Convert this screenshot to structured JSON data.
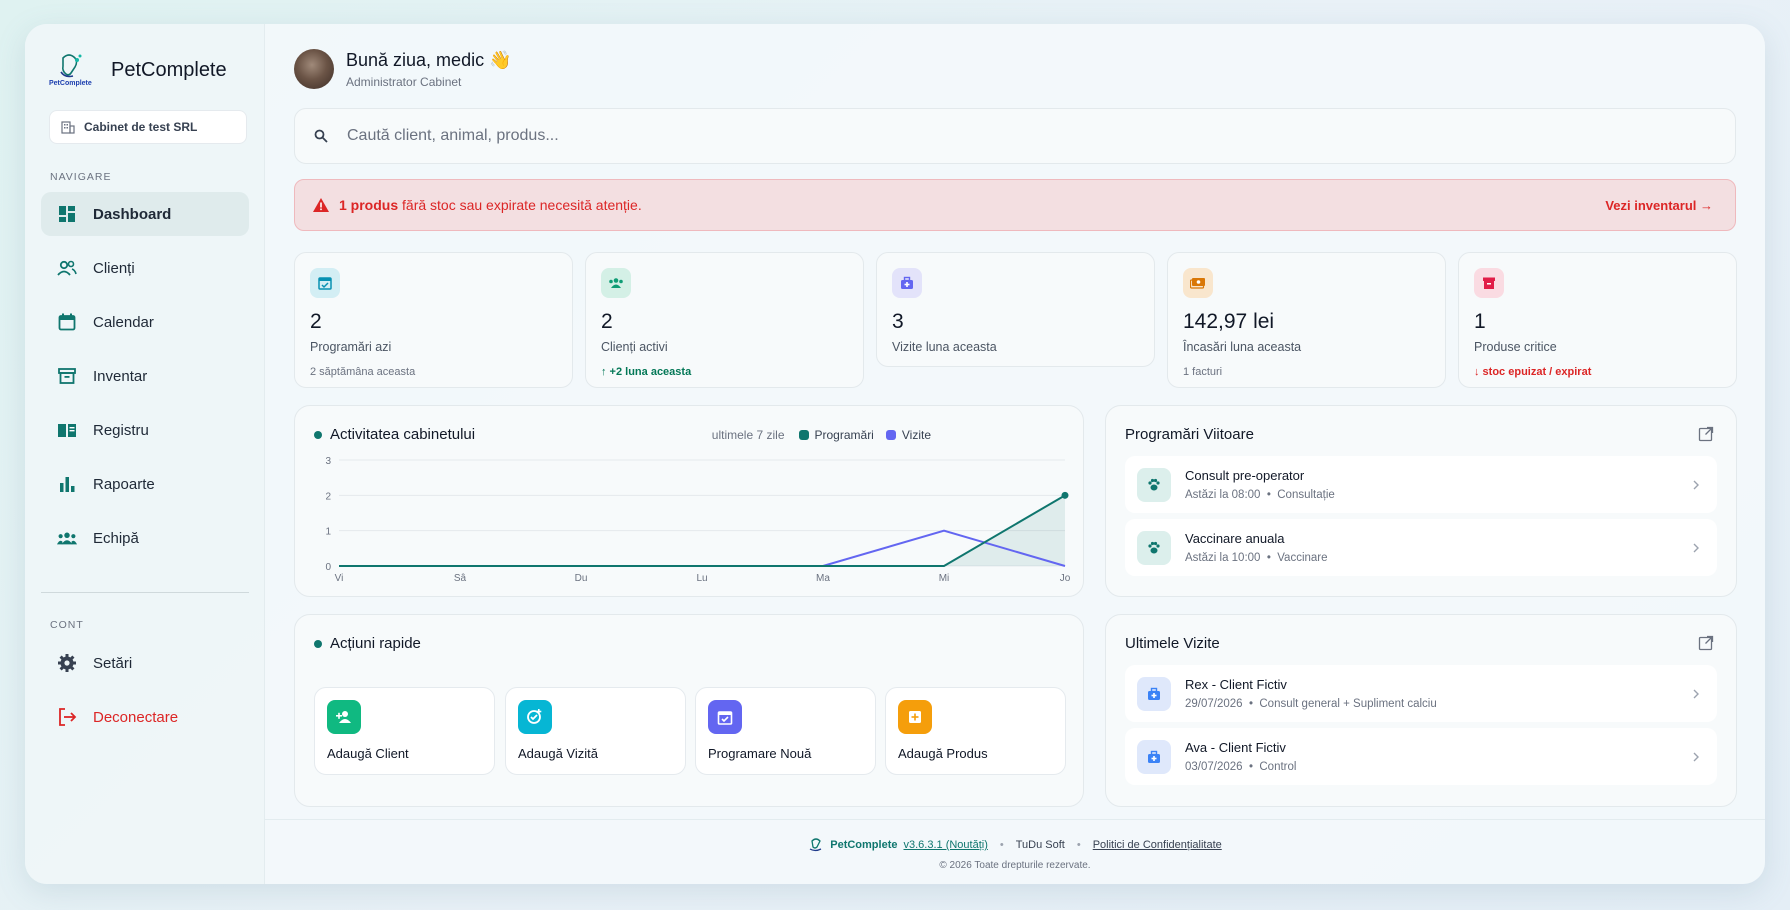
{
  "brand": {
    "name": "PetComplete",
    "logo_text": "PetComplete"
  },
  "clinic": {
    "name": "Cabinet de test SRL"
  },
  "sidebar": {
    "nav_label": "NAVIGARE",
    "items": [
      {
        "label": "Dashboard",
        "icon": "dashboard-icon",
        "active": true
      },
      {
        "label": "Clienți",
        "icon": "users-icon"
      },
      {
        "label": "Calendar",
        "icon": "calendar-icon"
      },
      {
        "label": "Inventar",
        "icon": "archive-icon"
      },
      {
        "label": "Registru",
        "icon": "book-icon"
      },
      {
        "label": "Rapoarte",
        "icon": "bar-chart-icon"
      },
      {
        "label": "Echipă",
        "icon": "team-icon"
      }
    ],
    "account_label": "CONT",
    "settings": "Setări",
    "logout": "Deconectare"
  },
  "header": {
    "greeting": "Bună ziua, medic 👋",
    "role": "Administrator Cabinet"
  },
  "search": {
    "placeholder": "Caută client, animal, produs..."
  },
  "alert": {
    "bold": "1 produs",
    "text": " fără stoc sau expirate necesită atenție.",
    "link": "Vezi inventarul →"
  },
  "stats": [
    {
      "value": "2",
      "label": "Programări azi",
      "sub": "2 săptămâna aceasta",
      "color": "#0891b2",
      "bg": "#d3eef4",
      "icon": "calendar-check-icon"
    },
    {
      "value": "2",
      "label": "Clienți activi",
      "sub": "↑ +2 luna aceasta",
      "color": "#0f9d75",
      "bg": "#d4f0e6",
      "icon": "users-icon"
    },
    {
      "value": "3",
      "label": "Vizite luna aceasta",
      "sub": "",
      "color": "#6366f1",
      "bg": "#e3e3fa",
      "icon": "medical-bag-icon"
    },
    {
      "value": "142,97 lei",
      "label": "Încasări luna aceasta",
      "sub": "1 facturi",
      "color": "#d97706",
      "bg": "#f9e6cd",
      "icon": "cash-icon"
    },
    {
      "value": "1",
      "label": "Produse critice",
      "sub": "↓ stoc epuizat / expirat",
      "color": "#e11d48",
      "bg": "#fadbe2",
      "icon": "archive-icon"
    }
  ],
  "activity": {
    "title": "Activitatea cabinetului",
    "note": "ultimele 7 zile",
    "legend": [
      {
        "name": "Programări",
        "color": "#0f766e"
      },
      {
        "name": "Vizite",
        "color": "#6366f1"
      }
    ]
  },
  "chart_data": {
    "type": "line",
    "categories": [
      "Vi",
      "Sâ",
      "Du",
      "Lu",
      "Ma",
      "Mi",
      "Jo"
    ],
    "series": [
      {
        "name": "Programări",
        "values": [
          0,
          0,
          0,
          0,
          0,
          0,
          2
        ],
        "color": "#0f766e"
      },
      {
        "name": "Vizite",
        "values": [
          0,
          0,
          0,
          0,
          0,
          1,
          0
        ],
        "color": "#6366f1"
      }
    ],
    "ylim": [
      0,
      3
    ],
    "yticks": [
      "0",
      "1",
      "2",
      "3"
    ],
    "grid": true
  },
  "quick": {
    "title": "Acțiuni rapide",
    "actions": [
      {
        "label": "Adaugă Client",
        "color": "#10b981",
        "icon": "add-user-icon"
      },
      {
        "label": "Adaugă Vizită",
        "color": "#06b6d4",
        "icon": "add-visit-icon"
      },
      {
        "label": "Programare Nouă",
        "color": "#6366f1",
        "icon": "calendar-icon"
      },
      {
        "label": "Adaugă Produs",
        "color": "#f59e0b",
        "icon": "add-product-icon"
      }
    ]
  },
  "upcoming": {
    "title": "Programări Viitoare",
    "items": [
      {
        "title": "Consult pre-operator",
        "meta": "Astăzi la 08:00  •  Consultație"
      },
      {
        "title": "Vaccinare anuala",
        "meta": "Astăzi la 10:00  •  Vaccinare"
      }
    ]
  },
  "visits": {
    "title": "Ultimele Vizite",
    "items": [
      {
        "title": "Rex - Client Fictiv",
        "meta": "29/07/2026  •  Consult general + Supliment calciu"
      },
      {
        "title": "Ava - Client Fictiv",
        "meta": "03/07/2026  •  Control"
      }
    ]
  },
  "footer": {
    "brand": "PetComplete",
    "version": "v3.6.3.1 (Noutăți)",
    "company": "TuDu Soft",
    "policy": "Politici de Confidențialitate",
    "copyright": "© 2026 Toate drepturile rezervate."
  }
}
